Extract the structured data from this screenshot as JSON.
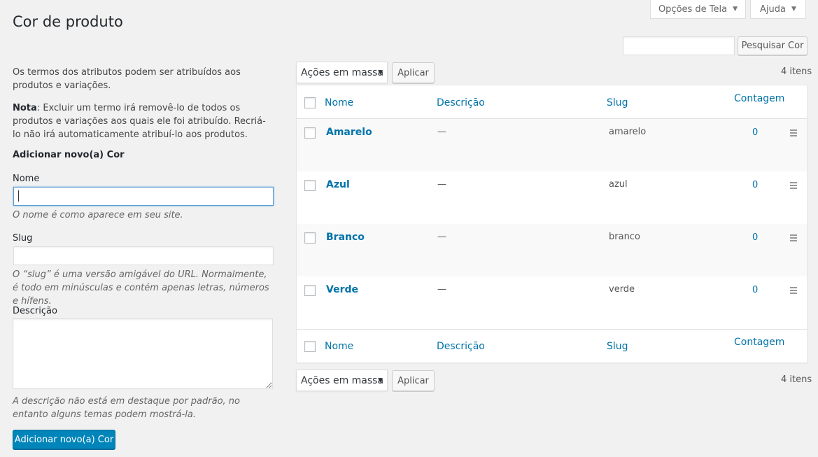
{
  "screen_tabs": {
    "options": "Opções de Tela",
    "help": "Ajuda"
  },
  "page": {
    "title": "Cor de produto"
  },
  "search": {
    "value": "",
    "button": "Pesquisar Cor"
  },
  "intro": {
    "text": "Os termos dos atributos podem ser atribuídos aos produtos e variações.",
    "note_label": "Nota",
    "note_text": ": Excluir um termo irá removê-lo de todos os produtos e variações aos quais ele foi atribuído. Recriá-lo não irá automaticamente atribuí-lo aos produtos."
  },
  "form": {
    "heading": "Adicionar novo(a) Cor",
    "name_label": "Nome",
    "name_value": "",
    "name_help": "O nome é como aparece em seu site.",
    "slug_label": "Slug",
    "slug_value": "",
    "slug_help": "O “slug” é uma versão amigável do URL. Normalmente, é todo em minúsculas e contém apenas letras, números e hífens.",
    "desc_label": "Descrição",
    "desc_value": "",
    "desc_help": "A descrição não está em destaque por padrão, no entanto alguns temas podem mostrá-la.",
    "submit": "Adicionar novo(a) Cor"
  },
  "bulk": {
    "selected": "Ações em massa",
    "apply": "Aplicar",
    "count": "4 itens"
  },
  "table": {
    "columns": {
      "name": "Nome",
      "description": "Descrição",
      "slug": "Slug",
      "count": "Contagem"
    },
    "rows": [
      {
        "name": "Amarelo",
        "description": "—",
        "slug": "amarelo",
        "count": "0"
      },
      {
        "name": "Azul",
        "description": "—",
        "slug": "azul",
        "count": "0"
      },
      {
        "name": "Branco",
        "description": "—",
        "slug": "branco",
        "count": "0"
      },
      {
        "name": "Verde",
        "description": "—",
        "slug": "verde",
        "count": "0"
      }
    ]
  },
  "icons": {
    "caret": "caret-down-icon",
    "drag": "drag-handle-icon"
  },
  "colors": {
    "link": "#0073aa",
    "primary_button": "#0085ba",
    "background": "#f1f1f1"
  }
}
